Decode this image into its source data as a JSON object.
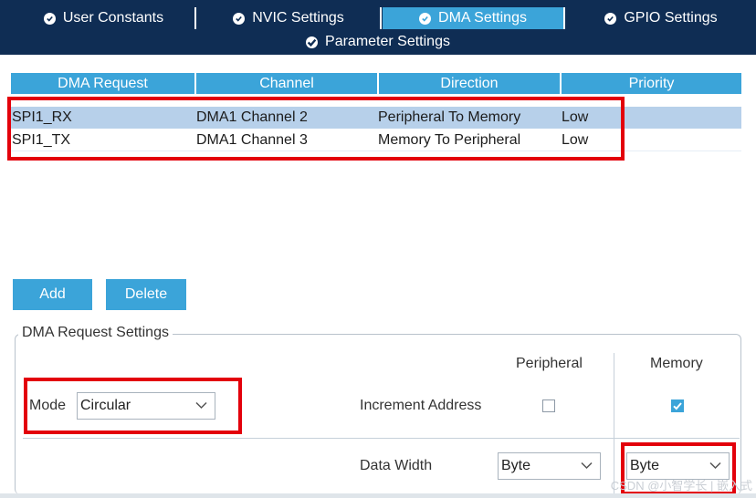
{
  "tabs": [
    {
      "label": "User Constants",
      "active": false
    },
    {
      "label": "NVIC Settings",
      "active": false
    },
    {
      "label": "DMA Settings",
      "active": true
    },
    {
      "label": "GPIO Settings",
      "active": false
    },
    {
      "label": "Parameter Settings",
      "active": false
    }
  ],
  "dma_table": {
    "columns": [
      "DMA Request",
      "Channel",
      "Direction",
      "Priority"
    ],
    "rows": [
      {
        "request": "SPI1_RX",
        "channel": "DMA1 Channel 2",
        "direction": "Peripheral To Memory",
        "priority": "Low",
        "selected": true
      },
      {
        "request": "SPI1_TX",
        "channel": "DMA1 Channel 3",
        "direction": "Memory To Peripheral",
        "priority": "Low",
        "selected": false
      }
    ]
  },
  "buttons": {
    "add": "Add",
    "delete": "Delete"
  },
  "request_settings": {
    "title": "DMA Request Settings",
    "peripheral_header": "Peripheral",
    "memory_header": "Memory",
    "mode_label": "Mode",
    "mode_value": "Circular",
    "increment_label": "Increment Address",
    "increment_peripheral": false,
    "increment_memory": true,
    "data_width_label": "Data Width",
    "data_width_peripheral": "Byte",
    "data_width_memory": "Byte"
  },
  "watermark": "CSDN @小智学长 | 嵌入式",
  "colors": {
    "tab_bg": "#0f2d54",
    "accent": "#3ba4d9",
    "selected_row": "#b7d0ea",
    "highlight_red": "#e3000b"
  }
}
